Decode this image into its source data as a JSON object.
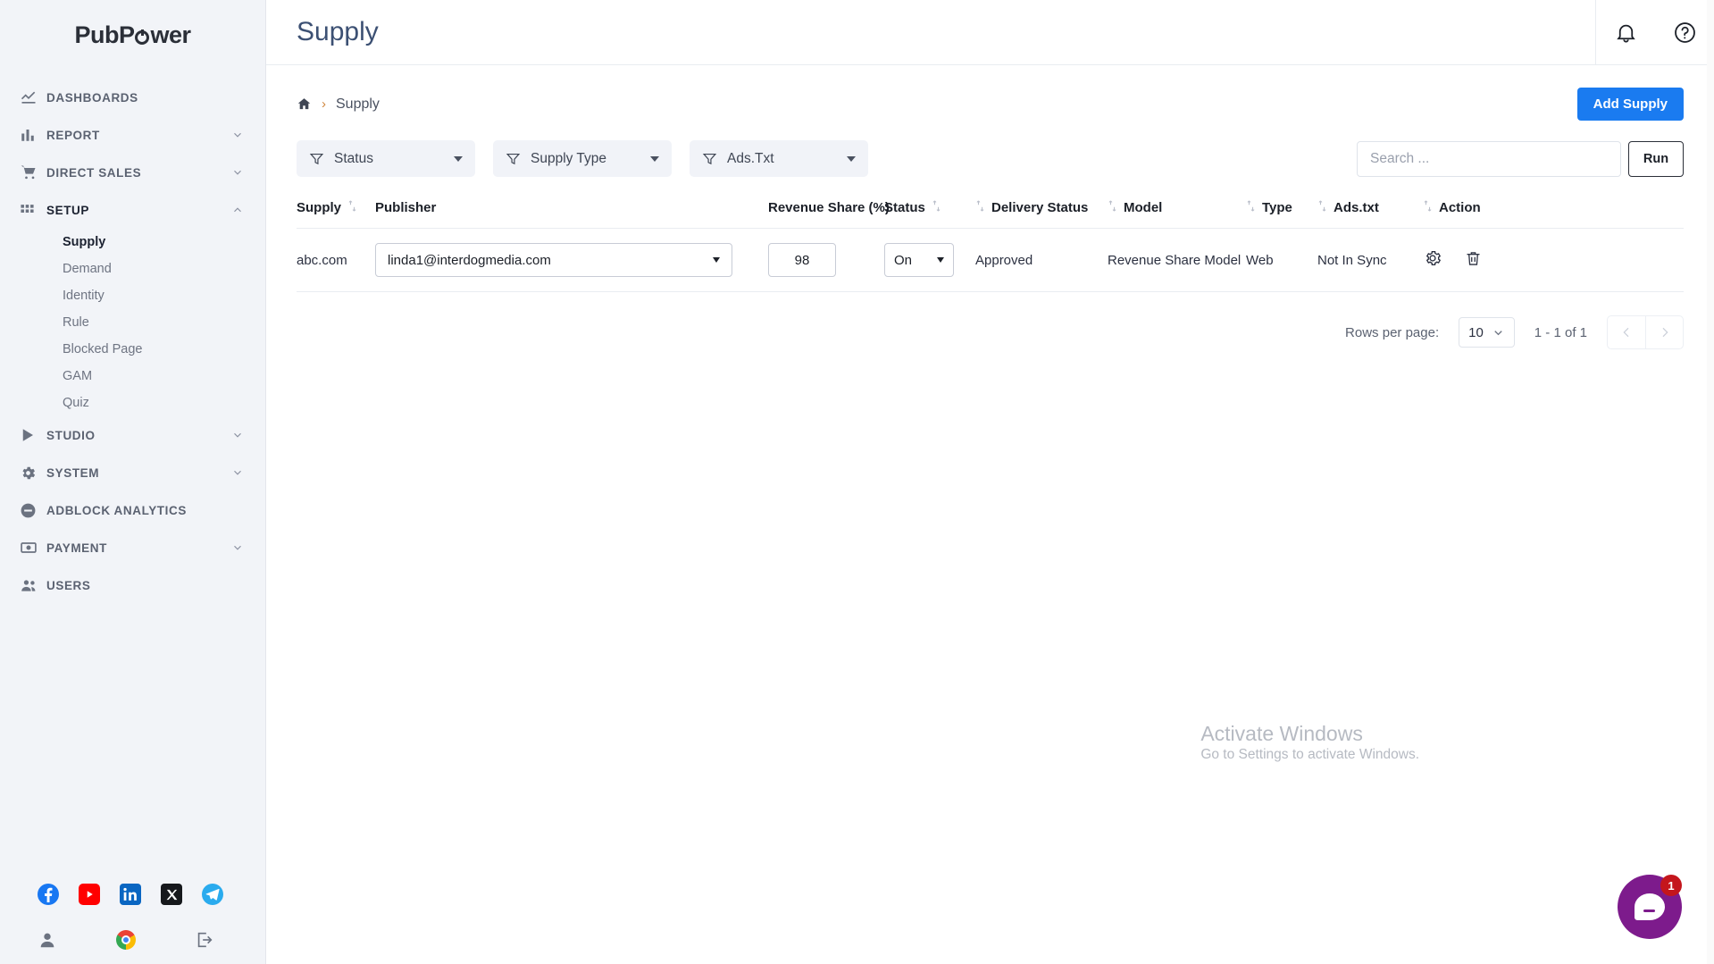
{
  "brand": {
    "name_part1": "PubP",
    "name_part2": "wer",
    "accent": "#1a7bf0"
  },
  "sidebar": {
    "items": [
      {
        "label": "DASHBOARDS",
        "icon": "chart-line-icon",
        "expandable": false
      },
      {
        "label": "REPORT",
        "icon": "bar-chart-icon",
        "expandable": true
      },
      {
        "label": "DIRECT SALES",
        "icon": "cart-icon",
        "expandable": true
      },
      {
        "label": "SETUP",
        "icon": "grid-icon",
        "expandable": true,
        "expanded": true
      },
      {
        "label": "STUDIO",
        "icon": "play-icon",
        "expandable": true
      },
      {
        "label": "SYSTEM",
        "icon": "gear-icon",
        "expandable": true
      },
      {
        "label": "ADBLOCK ANALYTICS",
        "icon": "minus-circle-icon",
        "expandable": false
      },
      {
        "label": "PAYMENT",
        "icon": "money-icon",
        "expandable": true
      },
      {
        "label": "USERS",
        "icon": "users-icon",
        "expandable": false
      }
    ],
    "setup_children": [
      {
        "label": "Supply",
        "active": true
      },
      {
        "label": "Demand",
        "active": false
      },
      {
        "label": "Identity",
        "active": false
      },
      {
        "label": "Rule",
        "active": false
      },
      {
        "label": "Blocked Page",
        "active": false
      },
      {
        "label": "GAM",
        "active": false
      },
      {
        "label": "Quiz",
        "active": false
      }
    ],
    "social": [
      {
        "name": "facebook-icon",
        "glyph": "f",
        "color": "#1877f2"
      },
      {
        "name": "youtube-icon",
        "glyph": "▶",
        "color": "#ff0000"
      },
      {
        "name": "linkedin-icon",
        "glyph": "in",
        "color": "#0a66c2"
      },
      {
        "name": "x-twitter-icon",
        "glyph": "𝕏",
        "color": "#16181c"
      },
      {
        "name": "telegram-icon",
        "glyph": "➤",
        "color": "#2aabee"
      }
    ],
    "bottom": [
      {
        "name": "profile-icon"
      },
      {
        "name": "chrome-icon"
      },
      {
        "name": "logout-icon"
      }
    ]
  },
  "header": {
    "title": "Supply",
    "notification_icon": "bell-icon",
    "help_icon": "help-circle-icon"
  },
  "breadcrumb": {
    "home_icon": "home-icon",
    "separator": "›",
    "current": "Supply"
  },
  "actions": {
    "add_supply_label": "Add Supply"
  },
  "filters": [
    {
      "label": "Status",
      "icon": "filter-icon"
    },
    {
      "label": "Supply Type",
      "icon": "filter-icon"
    },
    {
      "label": "Ads.Txt",
      "icon": "filter-icon"
    }
  ],
  "search": {
    "placeholder": "Search ...",
    "value": "",
    "run_label": "Run"
  },
  "table": {
    "columns": [
      {
        "label": "Supply",
        "sortable": false,
        "sort_after": true
      },
      {
        "label": "Publisher",
        "sortable": false
      },
      {
        "label": "Revenue Share (%)",
        "sortable": false
      },
      {
        "label": "Status",
        "sortable": false,
        "sort_after": true
      },
      {
        "label": "Delivery Status",
        "sortable": true
      },
      {
        "label": "Model",
        "sortable": true
      },
      {
        "label": "Type",
        "sortable": true
      },
      {
        "label": "Ads.txt",
        "sortable": true
      },
      {
        "label": "Action",
        "sortable": true
      }
    ],
    "rows": [
      {
        "supply": "abc.com",
        "publisher": "linda1@interdogmedia.com",
        "revenue_share": "98",
        "status": "On",
        "delivery_status": "Approved",
        "model": "Revenue Share Model",
        "type": "Web",
        "ads_txt": "Not In Sync",
        "settings_icon": "gear-icon",
        "delete_icon": "trash-icon"
      }
    ]
  },
  "pagination": {
    "rows_per_page_label": "Rows per page:",
    "rows_per_page_value": "10",
    "range_label": "1 - 1 of 1",
    "prev_icon": "chevron-left-icon",
    "next_icon": "chevron-right-icon"
  },
  "watermark": {
    "line1": "Activate Windows",
    "line2": "Go to Settings to activate Windows."
  },
  "chat": {
    "badge": "1",
    "icon": "chat-bubble-icon"
  }
}
